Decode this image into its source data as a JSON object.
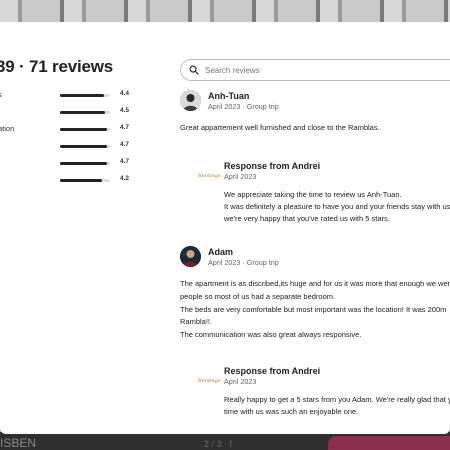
{
  "background": {
    "bottom_left_text": "ISBEN",
    "bottom_page_text": "2 / 3 · f"
  },
  "summary": {
    "heading": "39 · 71 reviews"
  },
  "categories": [
    {
      "label": "s",
      "score": "4.4",
      "level": 0.88
    },
    {
      "label": "",
      "score": "4.5",
      "level": 0.9
    },
    {
      "label": "ation",
      "score": "4.7",
      "level": 0.94
    },
    {
      "label": "",
      "score": "4.7",
      "level": 0.94
    },
    {
      "label": "",
      "score": "4.7",
      "level": 0.94
    },
    {
      "label": "",
      "score": "4.2",
      "level": 0.84
    }
  ],
  "search": {
    "placeholder": "Search reviews"
  },
  "reviews": [
    {
      "name": "Anh-Tuan",
      "meta": "April 2023 · Group trip",
      "body": [
        "Great appartement well furnished and close to the Ramblas."
      ],
      "response": {
        "host_logo_text": "Rentings",
        "name": "Response from Andrei",
        "date": "April 2023",
        "body": [
          "We appreciate taking the time to review us Anh-Tuan.",
          "It was definitely a pleasure to have you and your friends stay with us",
          "we're very happy that you've rated us with 5 stars."
        ]
      }
    },
    {
      "name": "Adam",
      "meta": "April 2023 · Group trip",
      "body": [
        "The apartment is as discribed,its huge and for us it was more that enough we wer",
        "people so most of us had a separate bedroom.",
        "The beds are very comfortable but most important was the location! It was 200m",
        "Rambla!!.",
        "The communication was also great always responsive."
      ],
      "response": {
        "host_logo_text": "Rentings",
        "name": "Response from Andrei",
        "date": "April 2023",
        "body": [
          "Really happy to get a 5 stars from you Adam. We're really glad that y",
          "time with us was such an enjoyable one."
        ]
      }
    }
  ]
}
